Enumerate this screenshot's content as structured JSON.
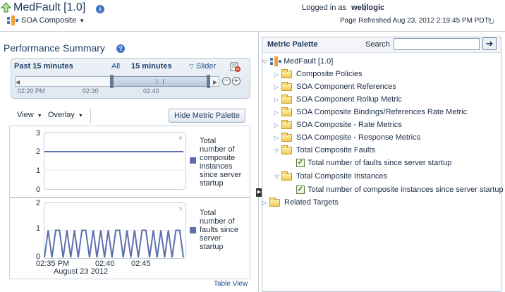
{
  "header": {
    "app_title": "MedFault [1.0]",
    "info_icon": "info-icon",
    "logged_in_label": "Logged in as",
    "user": "weblogic",
    "page_refreshed": "Page Refreshed Aug 23, 2012 2:19:45 PM PDT",
    "context_menu": "SOA Composite"
  },
  "performance": {
    "title": "Performance Summary",
    "past_label": "Past 15 minutes",
    "all_label": "All",
    "range_label": "15 minutes",
    "slider_label": "Slider",
    "times": [
      "02:20 PM",
      "02:30",
      "02:40"
    ],
    "view_label": "View",
    "overlay_label": "Overlay",
    "hide_button": "Hide Metric Palette",
    "table_view": "Table View",
    "x_labels": [
      "02:35 PM",
      "02:40",
      "02:45"
    ],
    "date_label": "August 23 2012"
  },
  "chart_data": [
    {
      "type": "line",
      "ylim": [
        0,
        3
      ],
      "yticks": [
        "3",
        "2",
        "1",
        "0"
      ],
      "series": [
        {
          "name": "Total number of composite instances since server startup",
          "values": [
            2,
            2,
            2,
            2,
            2,
            2,
            2,
            2
          ]
        }
      ]
    },
    {
      "type": "line",
      "ylim": [
        0,
        2
      ],
      "yticks": [
        "2",
        "1",
        "0"
      ],
      "x": [
        "02:35 PM",
        "02:40",
        "02:45"
      ],
      "series": [
        {
          "name": "Total number of faults since server startup",
          "values": [
            0,
            1,
            0,
            1,
            1,
            0,
            1,
            0,
            1,
            0,
            1,
            1,
            0,
            1,
            0,
            1,
            0,
            1,
            0,
            1,
            1,
            0,
            1,
            0,
            1,
            0,
            1,
            1,
            0,
            1,
            0,
            1,
            0,
            1,
            0,
            1,
            1,
            0
          ]
        }
      ]
    }
  ],
  "legend": {
    "chart1": "Total number of composite instances since server startup",
    "chart2": "Total number of faults since server startup",
    "color": "#5d6ead"
  },
  "palette": {
    "title": "Metric Palette",
    "search_label": "Search",
    "search_value": "",
    "root": "MedFault [1.0]",
    "items": [
      {
        "label": "Composite Policies",
        "expanded": false
      },
      {
        "label": "SOA Component References",
        "expanded": false
      },
      {
        "label": "SOA Component Rollup Metric",
        "expanded": false
      },
      {
        "label": "SOA Composite Bindings/References Rate Metric",
        "expanded": false
      },
      {
        "label": "SOA Composite - Rate Metrics",
        "expanded": false
      },
      {
        "label": "SOA Composite - Response Metrics",
        "expanded": false
      },
      {
        "label": "Total Composite Faults",
        "expanded": true
      },
      {
        "label": "Total number of faults since server startup",
        "checked": true
      },
      {
        "label": "Total Composite Instances",
        "expanded": true
      },
      {
        "label": "Total number of composite instances since server startup",
        "checked": true
      },
      {
        "label": "Related Targets",
        "expanded": false
      }
    ]
  }
}
